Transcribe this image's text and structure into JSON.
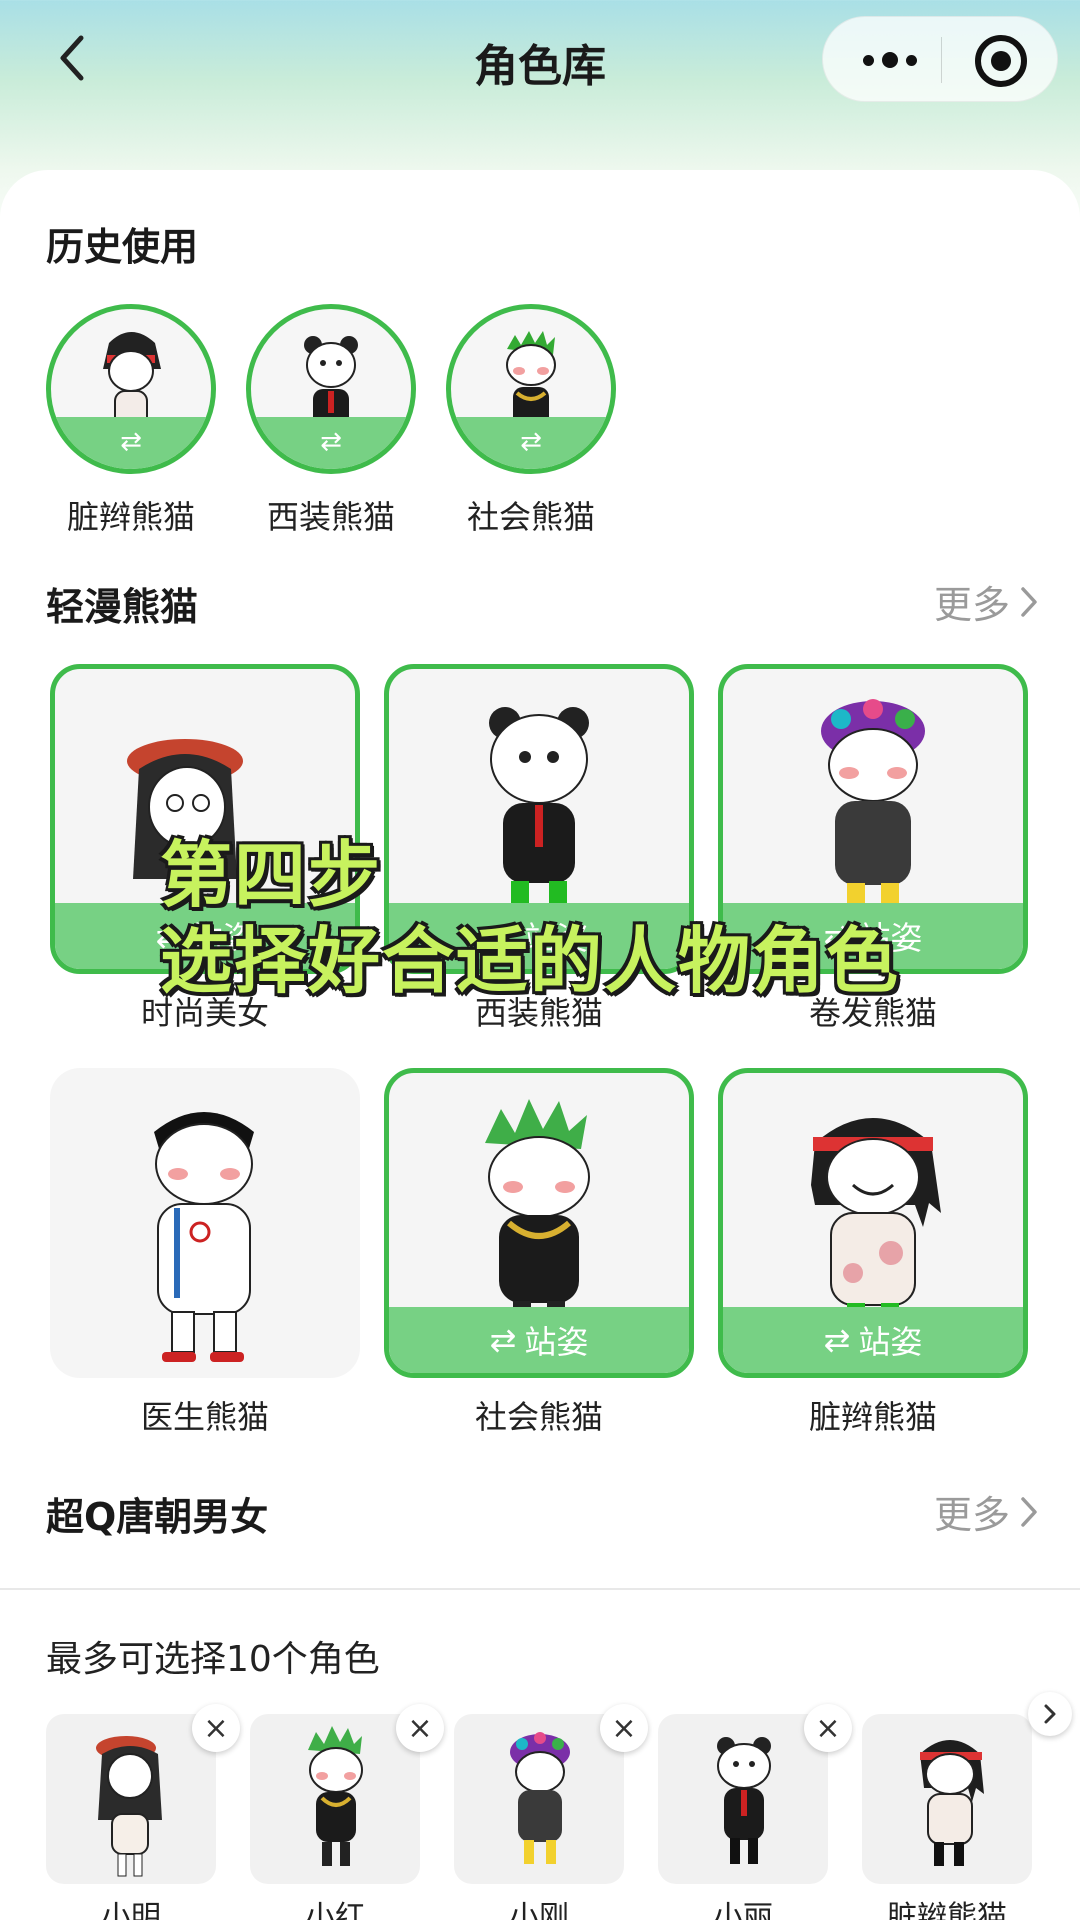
{
  "header": {
    "title": "角色库"
  },
  "history": {
    "title": "历史使用",
    "swap_label": "⇄",
    "items": [
      {
        "label": "脏辫熊猫"
      },
      {
        "label": "西装熊猫"
      },
      {
        "label": "社会熊猫"
      }
    ]
  },
  "section1": {
    "title": "轻漫熊猫",
    "more_label": "更多",
    "stance_label": "站姿",
    "items": [
      {
        "label": "时尚美女",
        "selected": true
      },
      {
        "label": "西装熊猫",
        "selected": true
      },
      {
        "label": "卷发熊猫",
        "selected": true
      },
      {
        "label": "医生熊猫",
        "selected": false
      },
      {
        "label": "社会熊猫",
        "selected": true
      },
      {
        "label": "脏辫熊猫",
        "selected": true
      }
    ]
  },
  "section2": {
    "title": "超Q唐朝男女",
    "more_label": "更多"
  },
  "caption": {
    "line1": "第四步",
    "line2": "选择好合适的人物角色"
  },
  "selected_panel": {
    "title": "最多可选择10个角色",
    "close_glyph": "×",
    "items": [
      {
        "label": "小明"
      },
      {
        "label": "小红"
      },
      {
        "label": "小刚"
      },
      {
        "label": "小丽"
      },
      {
        "label": "脏辫熊猫"
      }
    ]
  },
  "colors": {
    "accent_green": "#3fbb4b",
    "band_green": "#77d184",
    "caption_green": "#c7f25e"
  }
}
